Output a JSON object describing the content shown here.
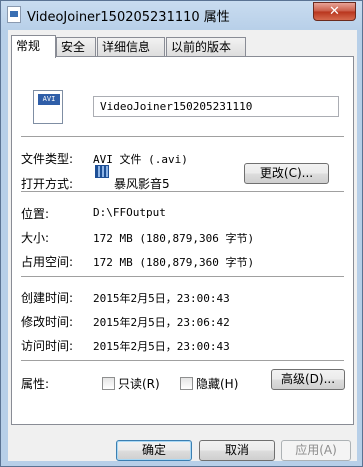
{
  "window": {
    "title": "VideoJoiner150205231110 属性",
    "close_label": "✕"
  },
  "tabs": [
    {
      "label": "常规",
      "active": true
    },
    {
      "label": "安全",
      "active": false
    },
    {
      "label": "详细信息",
      "active": false
    },
    {
      "label": "以前的版本",
      "active": false
    }
  ],
  "file": {
    "icon_label": "AVI",
    "name": "VideoJoiner150205231110"
  },
  "props": {
    "type_label": "文件类型:",
    "type_value": "AVI 文件 (.avi)",
    "open_label": "打开方式:",
    "open_value": "暴风影音5",
    "change_button": "更改(C)...",
    "location_label": "位置:",
    "location_value": "D:\\FFOutput",
    "size_label": "大小:",
    "size_value": "172 MB (180,879,306 字节)",
    "disk_label": "占用空间:",
    "disk_value": "172 MB (180,879,360 字节)",
    "created_label": "创建时间:",
    "created_value": "2015年2月5日，23:00:43",
    "modified_label": "修改时间:",
    "modified_value": "2015年2月5日，23:06:42",
    "accessed_label": "访问时间:",
    "accessed_value": "2015年2月5日，23:00:43",
    "attr_label": "属性:",
    "readonly_label": "只读(R)",
    "hidden_label": "隐藏(H)",
    "advanced_button": "高级(D)..."
  },
  "footer": {
    "ok": "确定",
    "cancel": "取消",
    "apply": "应用(A)"
  },
  "colors": {
    "title_gradient": "#c9dcf0",
    "close": "#c95a44",
    "default_button_border": "#3c7fb1"
  }
}
